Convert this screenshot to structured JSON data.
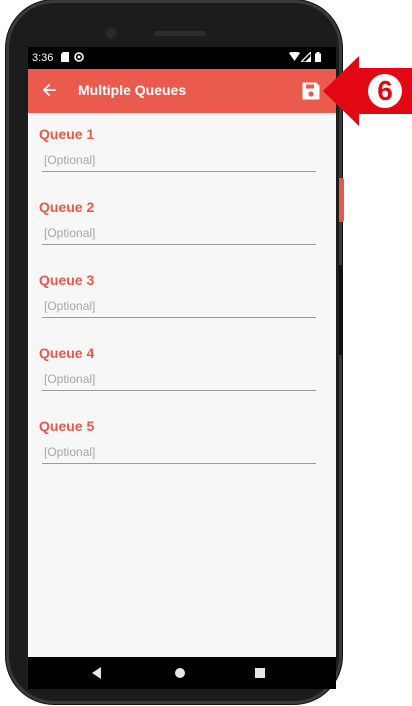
{
  "status_bar": {
    "time": "3:36",
    "icons": [
      "sd-card-icon",
      "sync-icon",
      "wifi-icon",
      "signal-icon",
      "battery-icon"
    ]
  },
  "app_bar": {
    "title": "Multiple Queues",
    "back_icon": "arrow-left-icon",
    "save_icon": "floppy-save-icon"
  },
  "queues": [
    {
      "label": "Queue 1",
      "value": "",
      "placeholder": "[Optional]"
    },
    {
      "label": "Queue 2",
      "value": "",
      "placeholder": "[Optional]"
    },
    {
      "label": "Queue 3",
      "value": "",
      "placeholder": "[Optional]"
    },
    {
      "label": "Queue 4",
      "value": "",
      "placeholder": "[Optional]"
    },
    {
      "label": "Queue 5",
      "value": "",
      "placeholder": "[Optional]"
    }
  ],
  "navigation": {
    "buttons": [
      "back-triangle-icon",
      "home-circle-icon",
      "recents-square-icon"
    ]
  },
  "callout": {
    "number": "6"
  },
  "colors": {
    "accent": "#ea5b4d",
    "label": "#e8584a",
    "background": "#f7f7f7",
    "callout_red": "#e30613"
  }
}
